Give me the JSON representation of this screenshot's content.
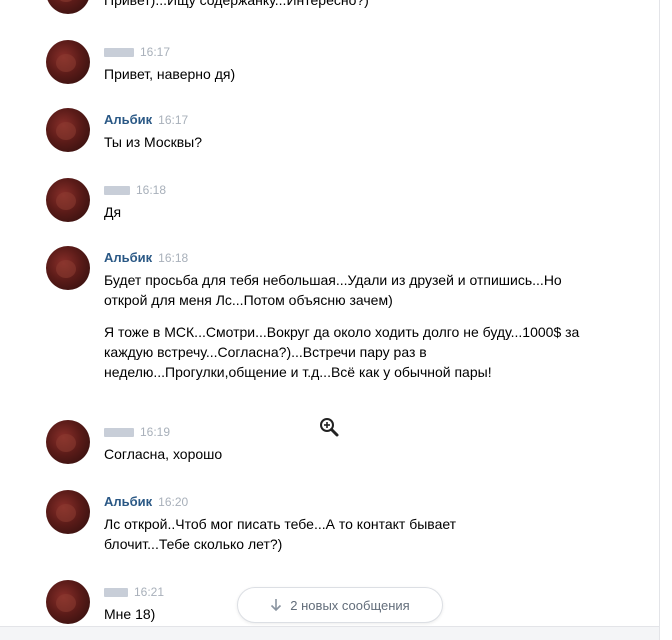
{
  "messages": [
    {
      "author": "",
      "author_hidden": true,
      "time": "",
      "lines": [
        "Привет)...Ищу содержанку...Интересно?)"
      ]
    },
    {
      "author": "",
      "author_hidden": true,
      "time": "16:17",
      "lines": [
        "Привет, наверно дя)"
      ]
    },
    {
      "author": "Альбик",
      "author_hidden": false,
      "time": "16:17",
      "lines": [
        "Ты из Москвы?"
      ]
    },
    {
      "author": "",
      "author_hidden": true,
      "time": "16:18",
      "lines": [
        "Дя"
      ]
    },
    {
      "author": "Альбик",
      "author_hidden": false,
      "time": "16:18",
      "lines": [
        "Будет просьба для тебя небольшая...Удали из друзей и отпишись...Но открой для меня Лс...Потом объясню зачем)",
        "Я тоже в МСК...Смотри...Вокруг да около ходить долго не буду...1000$ за каждую встречу...Согласна?)...Встречи пару раз в неделю...Прогулки,общение и т.д...Всё как у обычной пары!"
      ]
    },
    {
      "author": "",
      "author_hidden": true,
      "time": "16:19",
      "lines": [
        "Согласна, хорошо"
      ]
    },
    {
      "author": "Альбик",
      "author_hidden": false,
      "time": "16:20",
      "lines": [
        "Лс открой..Чтоб мог писать тебе...А то контакт бывает блочит...Тебе сколько лет?)"
      ]
    },
    {
      "author": "",
      "author_hidden": true,
      "time": "16:21",
      "lines": [
        "Мне 18)"
      ]
    }
  ],
  "new_messages_button": {
    "label": "2 новых сообщения",
    "icon": "arrow-down-icon"
  },
  "colors": {
    "author": "#2a5885",
    "time": "#a8b0ba",
    "button_text": "#626d7a"
  }
}
